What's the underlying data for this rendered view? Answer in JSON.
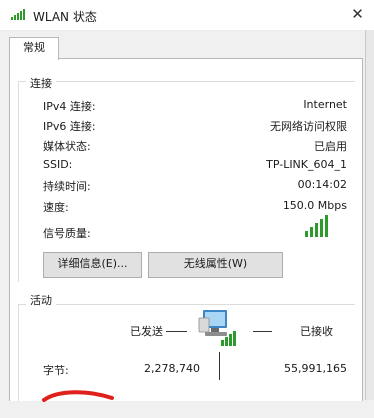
{
  "window": {
    "title": "WLAN 状态",
    "close_glyph": "✕"
  },
  "tabs": [
    {
      "label": "常规"
    }
  ],
  "connection": {
    "heading": "连接",
    "rows": [
      {
        "label": "IPv4 连接:",
        "value": "Internet"
      },
      {
        "label": "IPv6 连接:",
        "value": "无网络访问权限"
      },
      {
        "label": "媒体状态:",
        "value": "已启用"
      },
      {
        "label": "SSID:",
        "value": "TP-LINK_604_1"
      },
      {
        "label": "持续时间:",
        "value": "00:14:02"
      },
      {
        "label": "速度:",
        "value": "150.0 Mbps"
      },
      {
        "label": "信号质量:",
        "value": ""
      }
    ],
    "signal_icon": "signal-bars-icon",
    "signal_color": "#2e9a2e"
  },
  "buttons": {
    "details": "详细信息(E)...",
    "wireless_props": "无线属性(W)"
  },
  "activity": {
    "heading": "活动",
    "sent_label": "已发送",
    "received_label": "已接收",
    "bytes_label": "字节:",
    "bytes_sent": "2,278,740",
    "bytes_received": "55,991,165",
    "network_icon": "network-computer-icon"
  },
  "colors": {
    "annotation_red": "#e0201a"
  }
}
